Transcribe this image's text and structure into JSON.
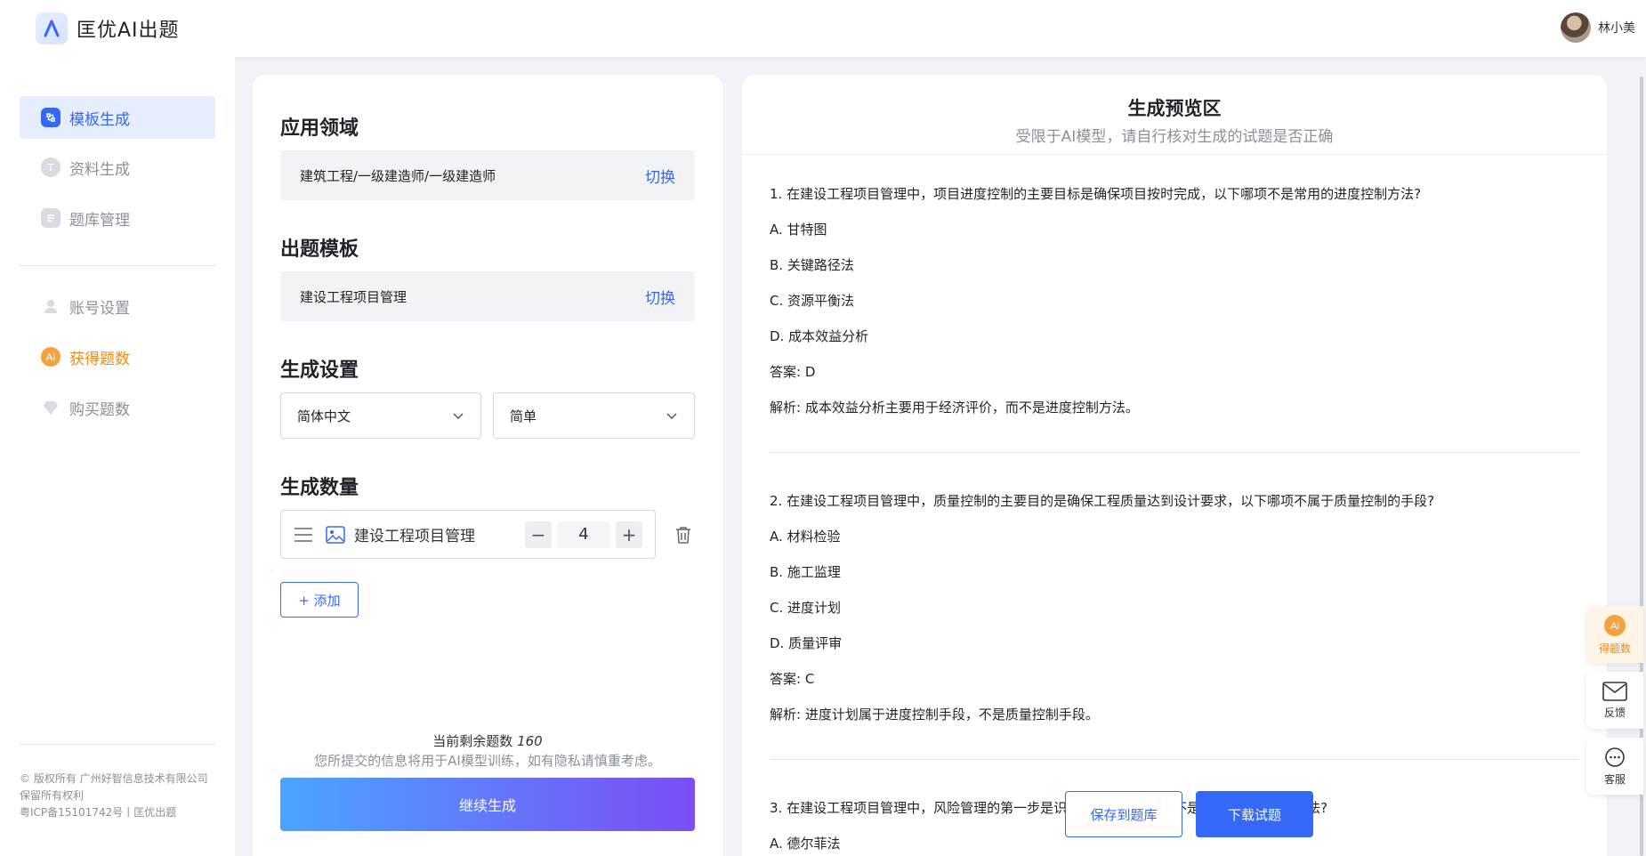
{
  "app": {
    "title": "匡优AI出题"
  },
  "user": {
    "name": "林小美"
  },
  "sidebar": {
    "items": [
      {
        "label": "模板生成",
        "icon": "template-icon"
      },
      {
        "label": "资料生成",
        "icon": "document-icon"
      },
      {
        "label": "题库管理",
        "icon": "question-bank-icon"
      },
      {
        "label": "账号设置",
        "icon": "user-icon"
      },
      {
        "label": "获得题数",
        "icon": "ai-coin-icon"
      },
      {
        "label": "购买题数",
        "icon": "diamond-icon"
      }
    ],
    "footer": {
      "copyright": "© 版权所有 广州好智信息技术有限公司",
      "rights": "保留所有权利",
      "icp": "粤ICP备15101742号丨匡优出题"
    }
  },
  "form": {
    "domain": {
      "title": "应用领域",
      "value": "建筑工程/一级建造师/一级建造师",
      "switch_label": "切换"
    },
    "template": {
      "title": "出题模板",
      "value": "建设工程项目管理",
      "switch_label": "切换"
    },
    "settings": {
      "title": "生成设置",
      "language": "简体中文",
      "difficulty": "简单"
    },
    "quantity": {
      "title": "生成数量",
      "item_label": "建设工程项目管理",
      "count": "4",
      "minus": "−",
      "plus": "+"
    },
    "add_label": "+ 添加",
    "remaining_label": "当前剩余题数",
    "remaining_count": "160",
    "notice": "您所提交的信息将用于AI模型训练，如有隐私请慎重考虑。",
    "generate_label": "继续生成"
  },
  "preview": {
    "title": "生成预览区",
    "subtitle": "受限于AI模型，请自行核对生成的试题是否正确",
    "questions": [
      {
        "stem": "1. 在建设工程项目管理中，项目进度控制的主要目标是确保项目按时完成，以下哪项不是常用的进度控制方法?",
        "options": [
          "A. 甘特图",
          "B. 关键路径法",
          "C. 资源平衡法",
          "D. 成本效益分析"
        ],
        "answer": "答案: D",
        "analysis": "解析: 成本效益分析主要用于经济评价，而不是进度控制方法。"
      },
      {
        "stem": "2. 在建设工程项目管理中，质量控制的主要目的是确保工程质量达到设计要求，以下哪项不属于质量控制的手段?",
        "options": [
          "A. 材料检验",
          "B. 施工监理",
          "C. 进度计划",
          "D. 质量评审"
        ],
        "answer": "答案: C",
        "analysis": "解析: 进度计划属于进度控制手段，不是质量控制手段。"
      },
      {
        "stem": "3. 在建设工程项目管理中，风险管理的第一步是识别风险，以下哪项不是常用的风险识别方法?",
        "options": [
          "A. 德尔菲法"
        ]
      }
    ],
    "save_label": "保存到题库",
    "download_label": "下载试题"
  },
  "float": {
    "credits_label": "得题数",
    "feedback_label": "反馈",
    "service_label": "客服"
  },
  "colors": {
    "primary": "#3468f6",
    "accent_orange": "#f08c1a",
    "bg": "#f1f3f8"
  }
}
